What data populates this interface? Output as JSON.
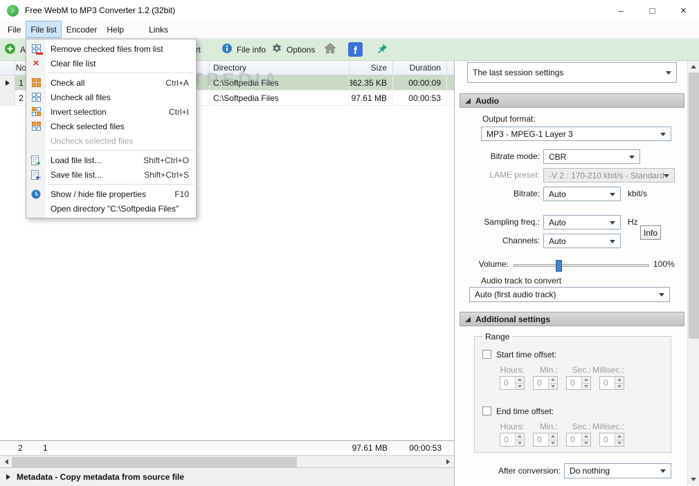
{
  "window": {
    "title": "Free WebM to MP3 Converter 1.2 (32bit)",
    "minimize_glyph": "–",
    "maximize_glyph": "□",
    "close_glyph": "×"
  },
  "menubar": {
    "items": [
      {
        "label": "File"
      },
      {
        "label": "File list"
      },
      {
        "label": "Encoder"
      },
      {
        "label": "Help"
      },
      {
        "label": "Links"
      }
    ]
  },
  "context_menu": {
    "items": [
      {
        "label": "Remove checked files from list"
      },
      {
        "label": "Clear file list"
      },
      {
        "label": "Check all",
        "shortcut": "Ctrl+A"
      },
      {
        "label": "Uncheck all files"
      },
      {
        "label": "Invert selection",
        "shortcut": "Ctrl+I"
      },
      {
        "label": "Check selected files"
      },
      {
        "label": "Uncheck selected files"
      },
      {
        "label": "Load file list...",
        "shortcut": "Shift+Ctrl+O"
      },
      {
        "label": "Save file list...",
        "shortcut": "Shift+Ctrl+S"
      },
      {
        "label": "Show / hide file properties",
        "shortcut": "F10"
      },
      {
        "label": "Open directory \"C:\\Softpedia Files\""
      }
    ]
  },
  "toolbar": {
    "add_label": "Add files...",
    "convert_label": "Convert",
    "file_info_label": "File info",
    "options_label": "Options"
  },
  "file_list": {
    "columns": {
      "no": "No",
      "directory": "Directory",
      "size": "Size",
      "duration": "Duration"
    },
    "rows": [
      {
        "no": "1",
        "directory": "C:\\Softpedia Files",
        "size": "362.35 KB",
        "duration": "00:00:09"
      },
      {
        "no": "2",
        "directory": "C:\\Softpedia Files",
        "size": "97.61 MB",
        "duration": "00:00:53"
      }
    ],
    "summary": {
      "total_files": "2",
      "checked_files": "1",
      "size": "97.61 MB",
      "duration": "00:00:53"
    },
    "watermark": "SOFTPEDIA"
  },
  "metadata_bar": {
    "label": "Metadata - Copy metadata from source file"
  },
  "settings": {
    "session_preset": "The last session settings",
    "audio": {
      "header": "Audio",
      "output_format_label": "Output format:",
      "output_format": "MP3 - MPEG-1 Layer 3",
      "bitrate_mode_label": "Bitrate mode:",
      "bitrate_mode": "CBR",
      "lame_preset_label": "LAME preset:",
      "lame_preset": "-V 2 : 170-210 kbit/s - Standard",
      "bitrate_label": "Bitrate:",
      "bitrate": "Auto",
      "bitrate_unit": "kbit/s",
      "sampling_label": "Sampling freq.:",
      "sampling": "Auto",
      "sampling_unit": "Hz",
      "info_button_label": "Info",
      "channels_label": "Channels:",
      "channels": "Auto",
      "volume_label": "Volume:",
      "volume_value": "100%",
      "audio_track_label": "Audio track to convert",
      "audio_track": "Auto (first audio track)"
    },
    "additional": {
      "header": "Additional settings",
      "range_label": "Range",
      "start_offset_label": "Start time offset:",
      "end_offset_label": "End time offset:",
      "hours_label": "Hours:",
      "min_label": "Min.:",
      "sec_label": "Sec.:",
      "millisec_label": "Millisec.:",
      "start_values": [
        "0",
        "0",
        "0",
        "0"
      ],
      "end_values": [
        "0",
        "0",
        "0",
        "0"
      ],
      "after_conversion_label": "After conversion:",
      "after_conversion": "Do nothing"
    }
  }
}
